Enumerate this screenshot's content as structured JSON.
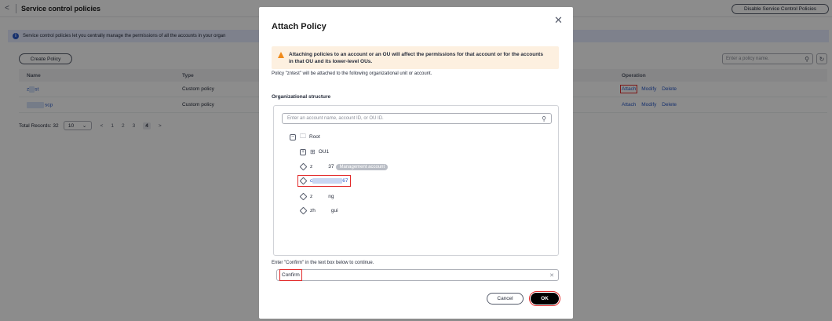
{
  "header": {
    "back_icon": "chevron-left-icon",
    "title": "Service control policies",
    "disable_button": "Disable Service Control Policies"
  },
  "info_banner": {
    "text": "Service control policies let you centrally manage the permissions of all the accounts in your organ"
  },
  "toolbar": {
    "create_button": "Create Policy",
    "search_placeholder": "Enter a policy name.",
    "refresh_icon": "refresh-icon"
  },
  "table": {
    "columns": [
      "Name",
      "Type",
      "Operation"
    ],
    "rows": [
      {
        "name_prefix": "z",
        "name_suffix": "st",
        "type": "Custom policy",
        "ops": [
          "Attach",
          "Modify",
          "Delete"
        ]
      },
      {
        "name_prefix": "",
        "name_suffix": "scp",
        "type": "Custom policy",
        "ops": [
          "Attach",
          "Modify",
          "Delete"
        ]
      }
    ]
  },
  "pagination": {
    "total": "Total Records: 32",
    "page_size": "10",
    "pages": [
      "1",
      "2",
      "3",
      "4"
    ],
    "current": "4"
  },
  "modal": {
    "title": "Attach Policy",
    "warning": "Attaching policies to an account or an OU will affect the permissions for that account or for the accounts in that OU and its lower-level OUs.",
    "note": "Policy \"zntest\" will be attached to the following organizational unit or account.",
    "org_label": "Organizational structure",
    "tree_search_placeholder": "Enter an account name, account ID, or OU ID.",
    "tree": {
      "root": "Root",
      "ou": "OU1",
      "acct1_prefix": "z",
      "acct1_suffix": "37",
      "mgmt_badge": "Management account",
      "acct2_prefix": "c",
      "acct2_suffix": "67",
      "acct3_prefix": "z",
      "acct3_suffix": "ng",
      "acct4_prefix": "zh",
      "acct4_suffix": "gui"
    },
    "confirm_label": "Enter \"Confirm\" in the text box below to continue.",
    "confirm_value": "Confirm",
    "cancel": "Cancel",
    "ok": "OK"
  },
  "colors": {
    "link": "#2a5ac8",
    "highlight": "#e22b2b",
    "warning_bg": "#fdf0e0",
    "primary_button": "#000000"
  }
}
